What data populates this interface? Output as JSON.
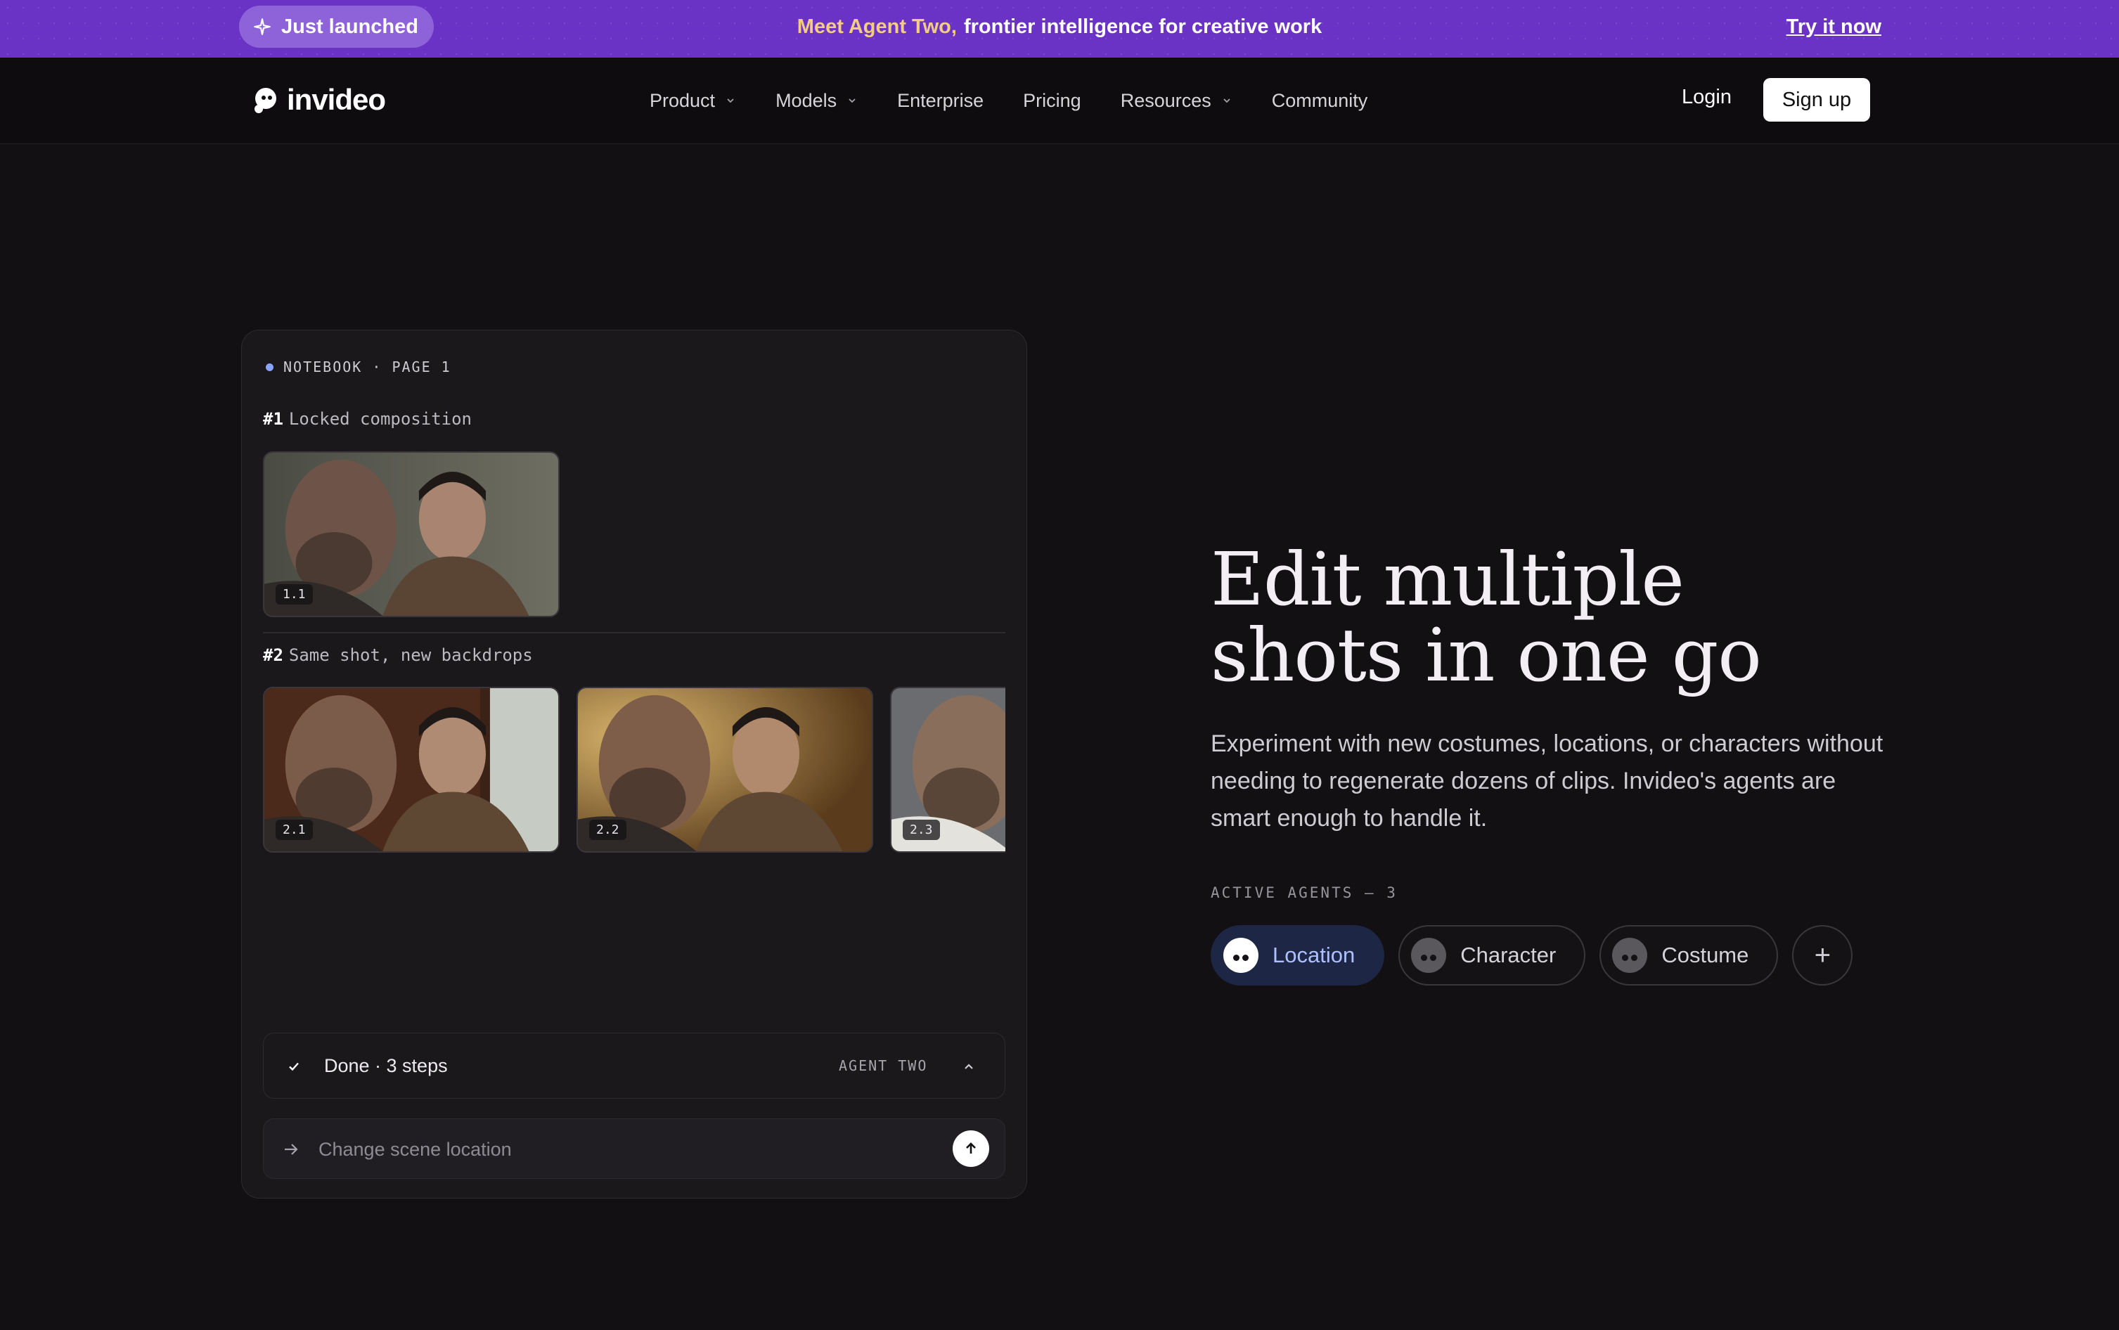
{
  "announcement": {
    "badge": "Just launched",
    "highlight": "Meet Agent Two,",
    "message": "frontier intelligence for creative work",
    "cta": "Try it now"
  },
  "header": {
    "logo_text": "invideo",
    "nav": [
      {
        "label": "Product",
        "dropdown": true
      },
      {
        "label": "Models",
        "dropdown": true
      },
      {
        "label": "Enterprise",
        "dropdown": false
      },
      {
        "label": "Pricing",
        "dropdown": false
      },
      {
        "label": "Resources",
        "dropdown": true
      },
      {
        "label": "Community",
        "dropdown": false
      }
    ],
    "login": "Login",
    "signup": "Sign up"
  },
  "notebook": {
    "eyebrow": "NOTEBOOK · PAGE 1",
    "sections": [
      {
        "num": "#1",
        "title": "Locked composition",
        "shots": [
          "1.1"
        ]
      },
      {
        "num": "#2",
        "title": "Same shot, new backdrops",
        "shots": [
          "2.1",
          "2.2",
          "2.3"
        ]
      }
    ],
    "status": {
      "text": "Done · 3 steps",
      "agent": "AGENT TWO"
    },
    "prompt": {
      "placeholder": "Change scene location"
    }
  },
  "hero": {
    "headline_line1": "Edit multiple",
    "headline_line2": "shots in one go",
    "subtext": "Experiment with new costumes, locations, or characters without needing to regenerate dozens of clips. Invideo's agents are smart enough to handle it.",
    "agents_label": "ACTIVE AGENTS — 3",
    "agents": [
      {
        "label": "Location",
        "active": true
      },
      {
        "label": "Character",
        "active": false
      },
      {
        "label": "Costume",
        "active": false
      }
    ],
    "add_label": "+"
  },
  "colors": {
    "accent": "#6b32c6",
    "background": "#121012",
    "active_chip": "#1d2644"
  }
}
